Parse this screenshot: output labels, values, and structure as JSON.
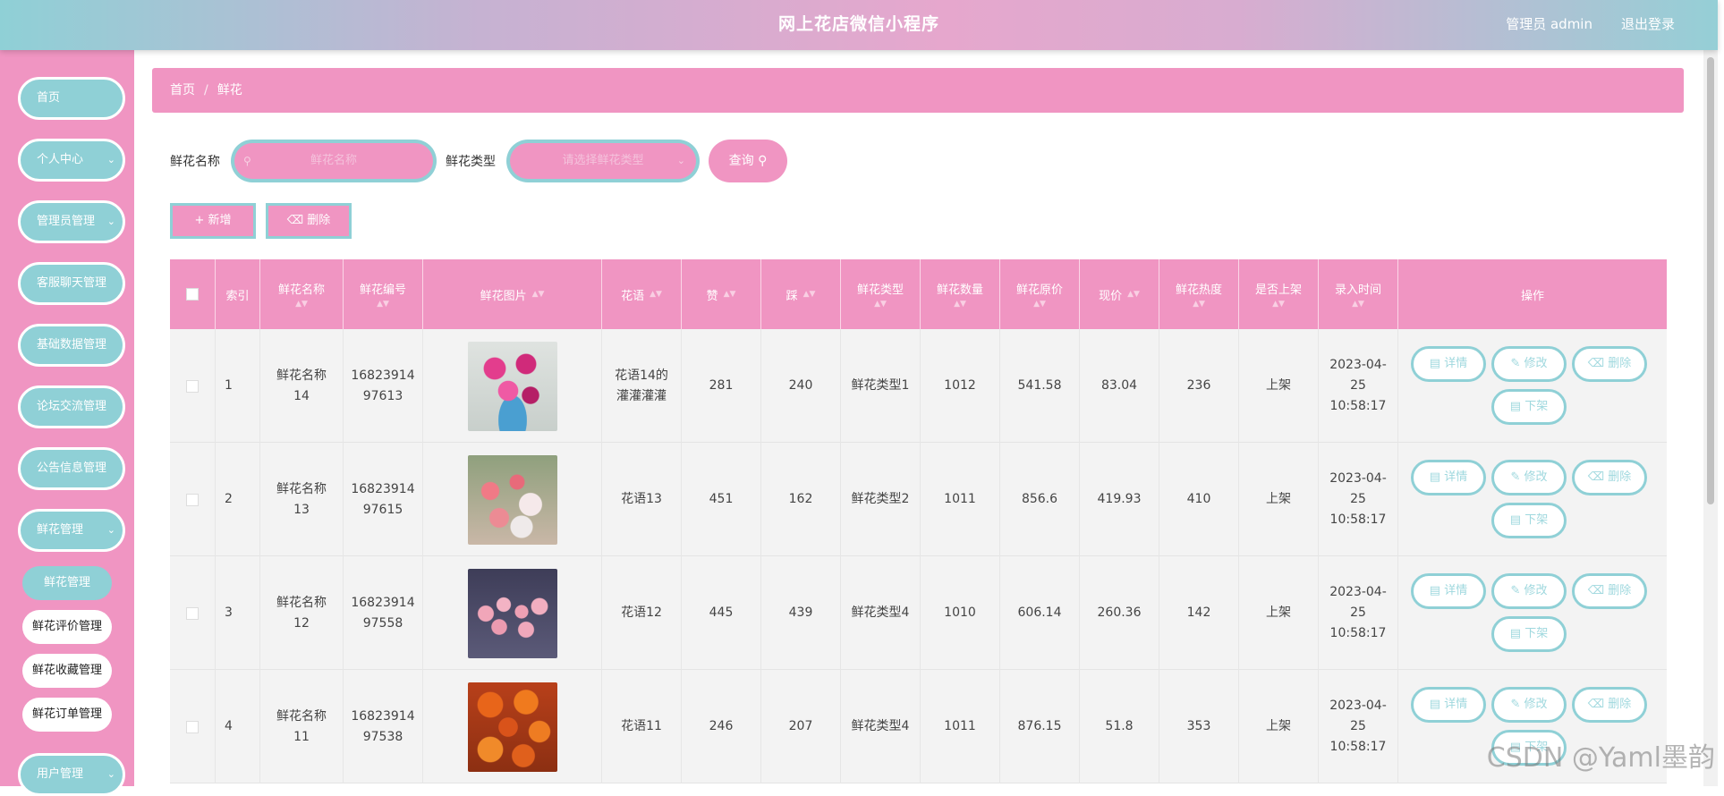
{
  "header": {
    "title": "网上花店微信小程序",
    "user": "管理员 admin",
    "logout": "退出登录"
  },
  "sidebar": {
    "items": [
      {
        "label": "首页"
      },
      {
        "label": "个人中心"
      },
      {
        "label": "管理员管理"
      },
      {
        "label": "客服聊天管理"
      },
      {
        "label": "基础数据管理"
      },
      {
        "label": "论坛交流管理"
      },
      {
        "label": "公告信息管理"
      },
      {
        "label": "鲜花管理"
      },
      {
        "label": "用户管理"
      }
    ],
    "submenu": [
      {
        "label": "鲜花管理"
      },
      {
        "label": "鲜花评价管理"
      },
      {
        "label": "鲜花收藏管理"
      },
      {
        "label": "鲜花订单管理"
      }
    ]
  },
  "breadcrumb": {
    "home": "首页",
    "separator": "/",
    "current": "鲜花"
  },
  "search": {
    "name_label": "鲜花名称",
    "name_placeholder": "鲜花名称",
    "type_label": "鲜花类型",
    "type_placeholder": "请选择鲜花类型",
    "query_label": "查询"
  },
  "actions": {
    "add": "新增",
    "delete": "删除"
  },
  "table": {
    "columns": [
      "索引",
      "鲜花名称",
      "鲜花编号",
      "鲜花图片",
      "花语",
      "赞",
      "踩",
      "鲜花类型",
      "鲜花数量",
      "鲜花原价",
      "现价",
      "鲜花热度",
      "是否上架",
      "录入时间",
      "操作"
    ],
    "rows": [
      {
        "index": "1",
        "name": "鲜花名称14",
        "code": "1682391497613",
        "image": "pink-lilies-bouquet",
        "language": "花语14的灌灌灌灌",
        "like": "281",
        "dislike": "240",
        "type": "鲜花类型1",
        "quantity": "1012",
        "original_price": "541.58",
        "price": "83.04",
        "heat": "236",
        "status": "上架",
        "time": "2023-04-25 10:58:17"
      },
      {
        "index": "2",
        "name": "鲜花名称13",
        "code": "1682391497615",
        "image": "pink-carnations-bouquet",
        "language": "花语13",
        "like": "451",
        "dislike": "162",
        "type": "鲜花类型2",
        "quantity": "1011",
        "original_price": "856.6",
        "price": "419.93",
        "heat": "410",
        "status": "上架",
        "time": "2023-04-25 10:58:17"
      },
      {
        "index": "3",
        "name": "鲜花名称12",
        "code": "1682391497558",
        "image": "pink-roses-bouquet",
        "language": "花语12",
        "like": "445",
        "dislike": "439",
        "type": "鲜花类型4",
        "quantity": "1010",
        "original_price": "606.14",
        "price": "260.36",
        "heat": "142",
        "status": "上架",
        "time": "2023-04-25 10:58:17"
      },
      {
        "index": "4",
        "name": "鲜花名称11",
        "code": "1682391497538",
        "image": "orange-gerberas-bouquet",
        "language": "花语11",
        "like": "246",
        "dislike": "207",
        "type": "鲜花类型4",
        "quantity": "1011",
        "original_price": "876.15",
        "price": "51.8",
        "heat": "353",
        "status": "上架",
        "time": "2023-04-25 10:58:17"
      }
    ],
    "row_actions": {
      "detail": "详情",
      "edit": "修改",
      "delete": "删除",
      "offline": "下架"
    }
  },
  "watermark": "CSDN @Yaml墨韵",
  "colors": {
    "pink": "#f095c2",
    "teal": "#8fd0d6",
    "row_bg": "#f3f3f3"
  }
}
